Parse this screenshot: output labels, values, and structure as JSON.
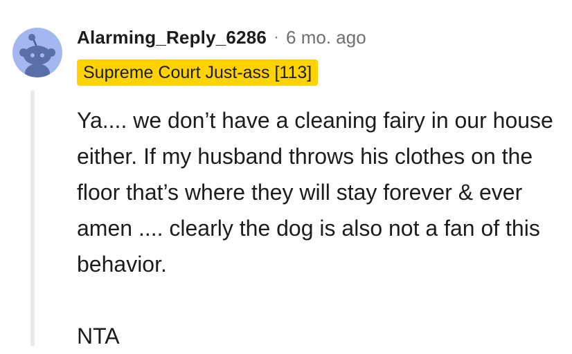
{
  "comment": {
    "username": "Alarming_Reply_6286",
    "separator": "·",
    "timestamp": "6 mo. ago",
    "flair": "Supreme Court Just-ass [113]",
    "flair_color": "#ffd300",
    "avatar_icon": "snoo-avatar-icon",
    "avatar_color": "#a5b7f1",
    "body_paragraph": "Ya.... we don’t have a cleaning fairy in our house either. If my husband throws his clothes on the floor that’s where they will stay forever & ever amen .... clearly the dog is also not a fan of this behavior.",
    "verdict": "NTA"
  }
}
